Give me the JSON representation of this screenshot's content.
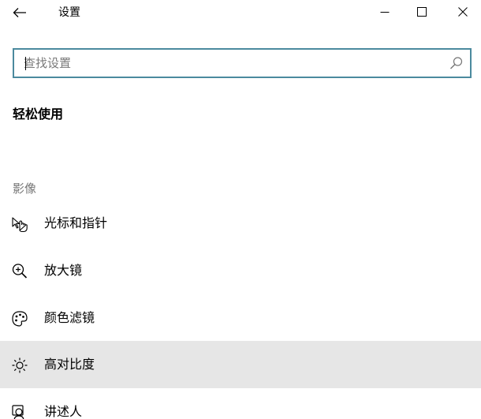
{
  "window": {
    "title": "设置"
  },
  "search": {
    "value": "",
    "placeholder": "查找设置"
  },
  "page": {
    "title": "轻松使用",
    "section": "影像"
  },
  "nav": {
    "items": [
      {
        "label": "光标和指针",
        "icon": "cursor-pointer-icon",
        "selected": false
      },
      {
        "label": "放大镜",
        "icon": "magnifier-icon",
        "selected": false
      },
      {
        "label": "颜色滤镜",
        "icon": "palette-icon",
        "selected": false
      },
      {
        "label": "高对比度",
        "icon": "brightness-icon",
        "selected": true
      },
      {
        "label": "讲述人",
        "icon": "narrator-icon",
        "selected": false
      }
    ]
  },
  "colors": {
    "search_border": "#4b8a9e",
    "selected_bg": "#e6e6e6",
    "section_label": "#767676"
  }
}
